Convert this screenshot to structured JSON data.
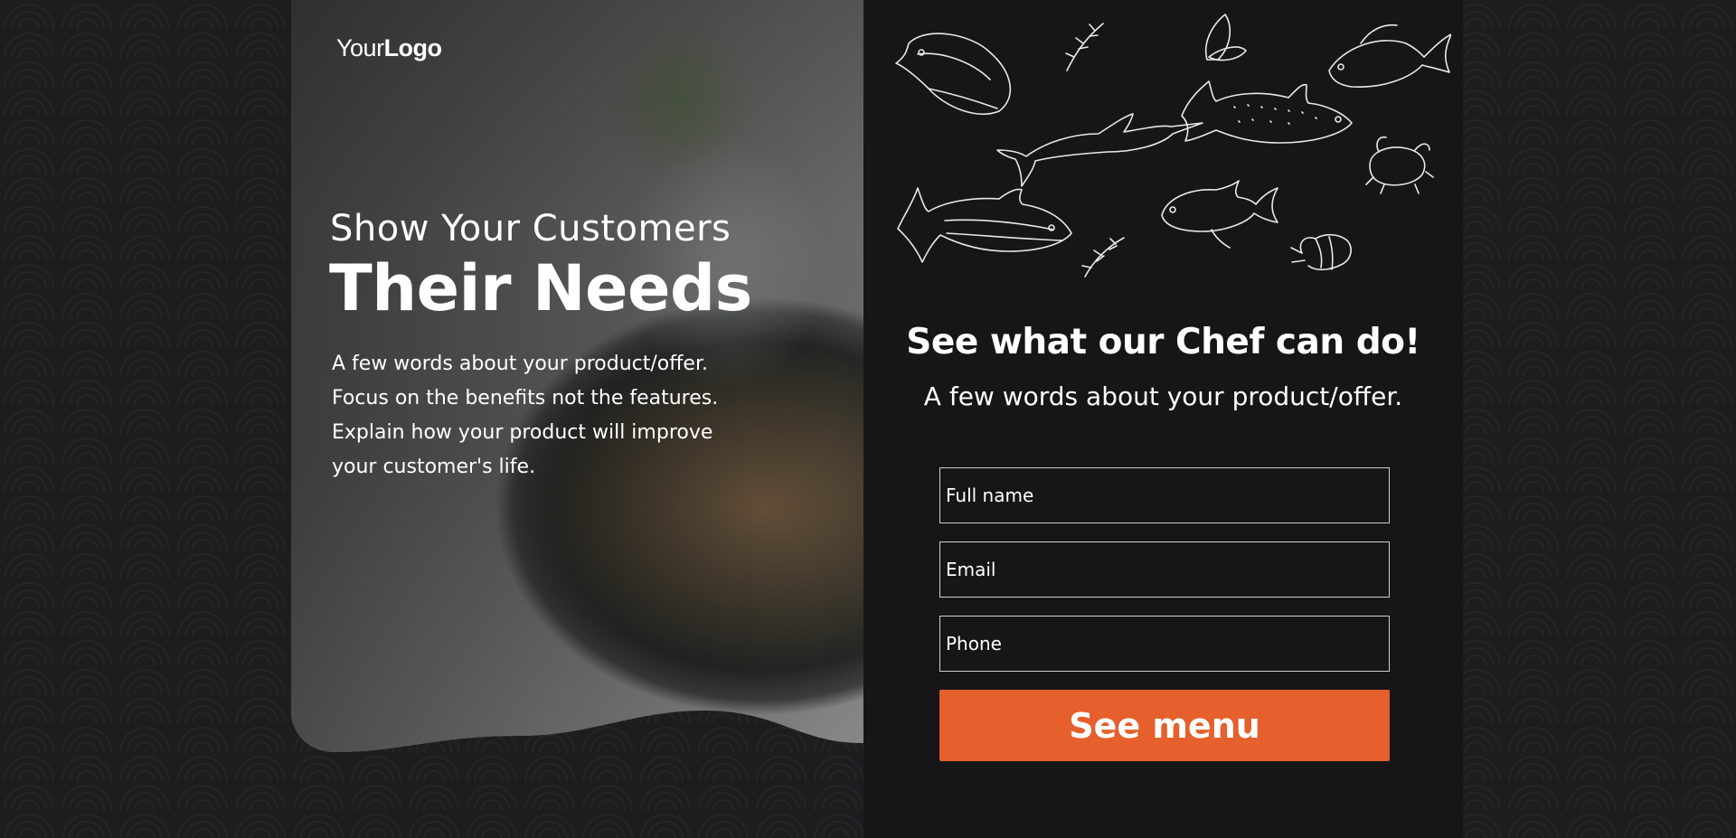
{
  "logo": {
    "light": "Your",
    "bold": "Logo"
  },
  "hero": {
    "headline_small": "Show Your Customers",
    "headline_big": "Their Needs",
    "body_lines": [
      "A few words about your product/offer.",
      "Focus on the benefits not the features.",
      "Explain how your product will improve",
      "your customer's life."
    ],
    "image_icon": "sushi-plate-photo"
  },
  "form": {
    "title": "See what our Chef can do!",
    "subtitle": "A few words about your product/offer.",
    "fields": {
      "full_name": {
        "placeholder": "Full name",
        "value": ""
      },
      "email": {
        "placeholder": "Email",
        "value": ""
      },
      "phone": {
        "placeholder": "Phone",
        "value": ""
      }
    },
    "submit_label": "See menu",
    "illustration_icon": "seafood-sketch-illustration"
  },
  "colors": {
    "page_background": "#1d1d20",
    "panel_background": "#161618",
    "accent": "#e5602c",
    "text": "#ffffff"
  }
}
